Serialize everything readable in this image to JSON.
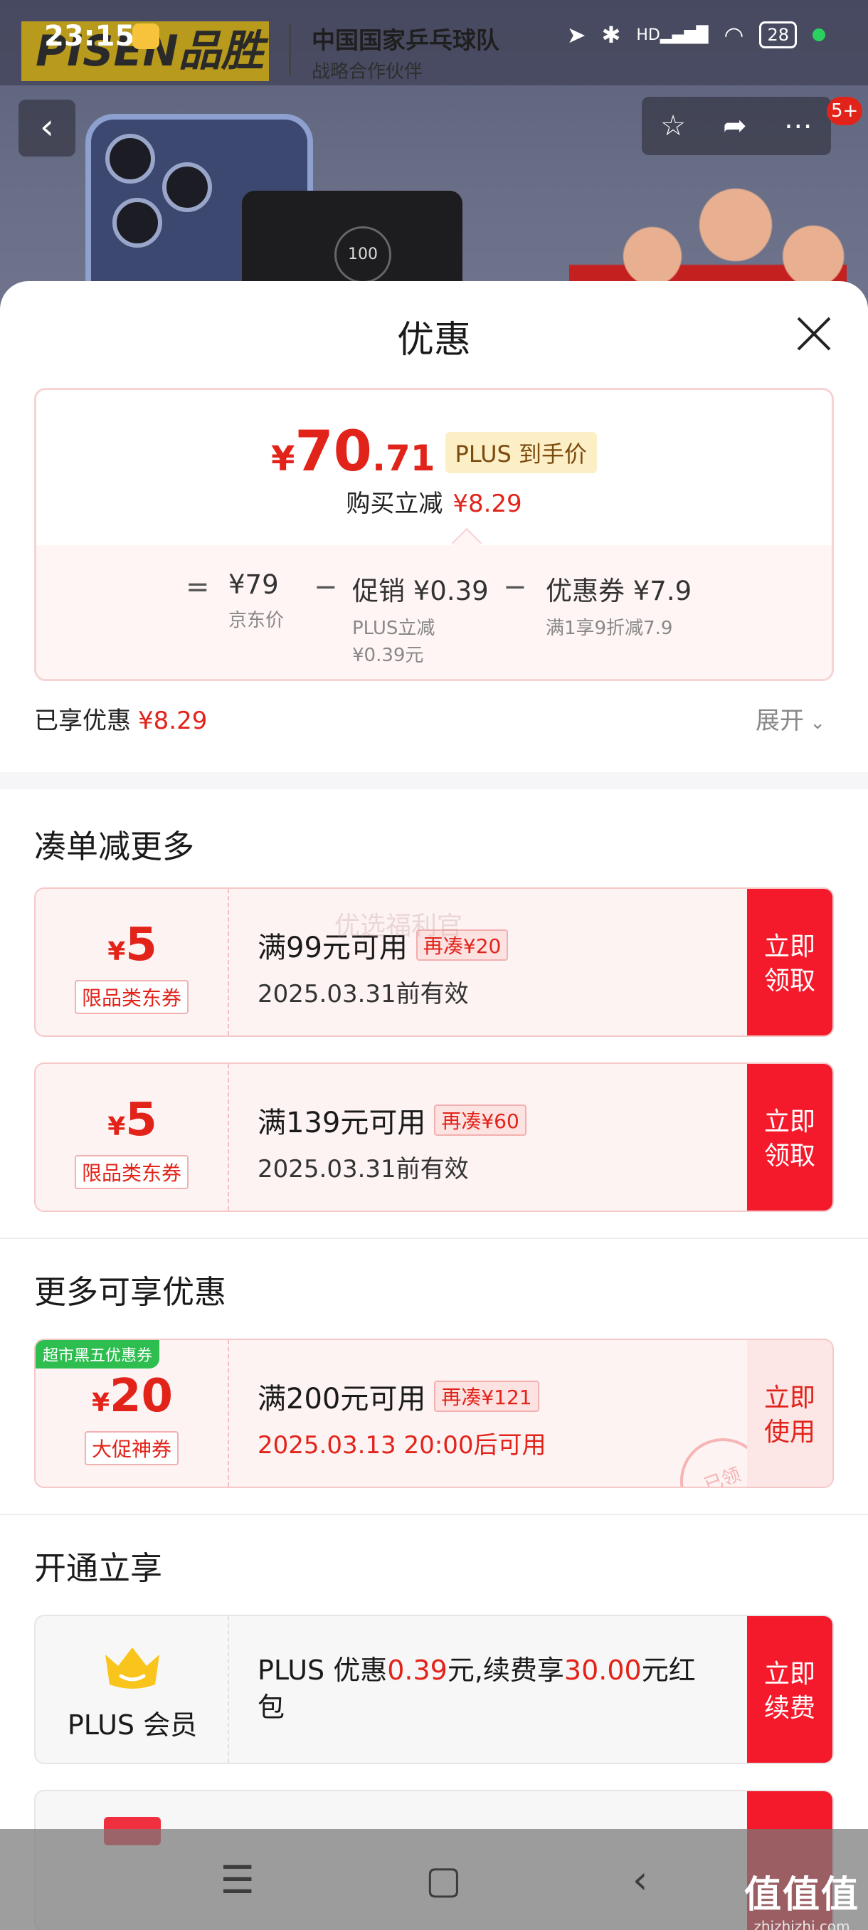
{
  "status_bar": {
    "time": "23:15",
    "battery": "28",
    "hd_label": "HD"
  },
  "banner": {
    "brand": "PISEN品胜",
    "partner_title": "中国国家乒乓球队",
    "partner_sub": "战略合作伙伴",
    "powerbank_screen": "100"
  },
  "top_nav": {
    "message_badge": "5+"
  },
  "sheet": {
    "title": "优惠",
    "price": {
      "yen": "¥",
      "int": "70",
      "dec": ".71",
      "tag": "PLUS 到手价",
      "reduce_label": "购买立减",
      "reduce_value": "¥8.29"
    },
    "calc": {
      "eq": "=",
      "items": [
        {
          "main": "¥79",
          "sub": "京东价"
        },
        {
          "main": "促销 ¥0.39",
          "sub": "PLUS立减\n¥0.39元"
        },
        {
          "main": "优惠券 ¥7.9",
          "sub": "满1享9折减7.9"
        }
      ],
      "minus": "−"
    },
    "enjoyed_label": "已享优惠",
    "enjoyed_value": "¥8.29",
    "expand_label": "展开"
  },
  "sections": {
    "more_order": "凑单减更多",
    "more_benefits": "更多可享优惠",
    "open_enjoy": "开通立享"
  },
  "coupons": [
    {
      "yen": "¥",
      "amount": "5",
      "kind": "限品类东券",
      "cond": "满99元可用",
      "tag": "再凑¥20",
      "valid": "2025.03.31前有效",
      "action": "立即\n领取"
    },
    {
      "yen": "¥",
      "amount": "5",
      "kind": "限品类东券",
      "cond": "满139元可用",
      "tag": "再凑¥60",
      "valid": "2025.03.31前有效",
      "action": "立即\n领取"
    },
    {
      "ribbon": "超市黑五优惠券",
      "yen": "¥",
      "amount": "20",
      "kind": "大促神券",
      "cond": "满200元可用",
      "tag": "再凑¥121",
      "valid": "2025.03.13 20:00后可用",
      "action": "立即\n使用",
      "stamp": "已领"
    }
  ],
  "plus": {
    "name": "PLUS 会员",
    "text_1": "PLUS 优惠",
    "value_1": "0.39",
    "text_2": "元,续费享",
    "value_2": "30.00",
    "text_3": "元红包",
    "action": "立即\n续费"
  },
  "watermark": {
    "big": "值值值",
    "small": "zhizhizhi.com",
    "overlay": "优选福利官"
  },
  "colors": {
    "accent_red": "#e2231a",
    "action_red": "#f51a2b",
    "ribbon_green": "#2ebd4f"
  }
}
